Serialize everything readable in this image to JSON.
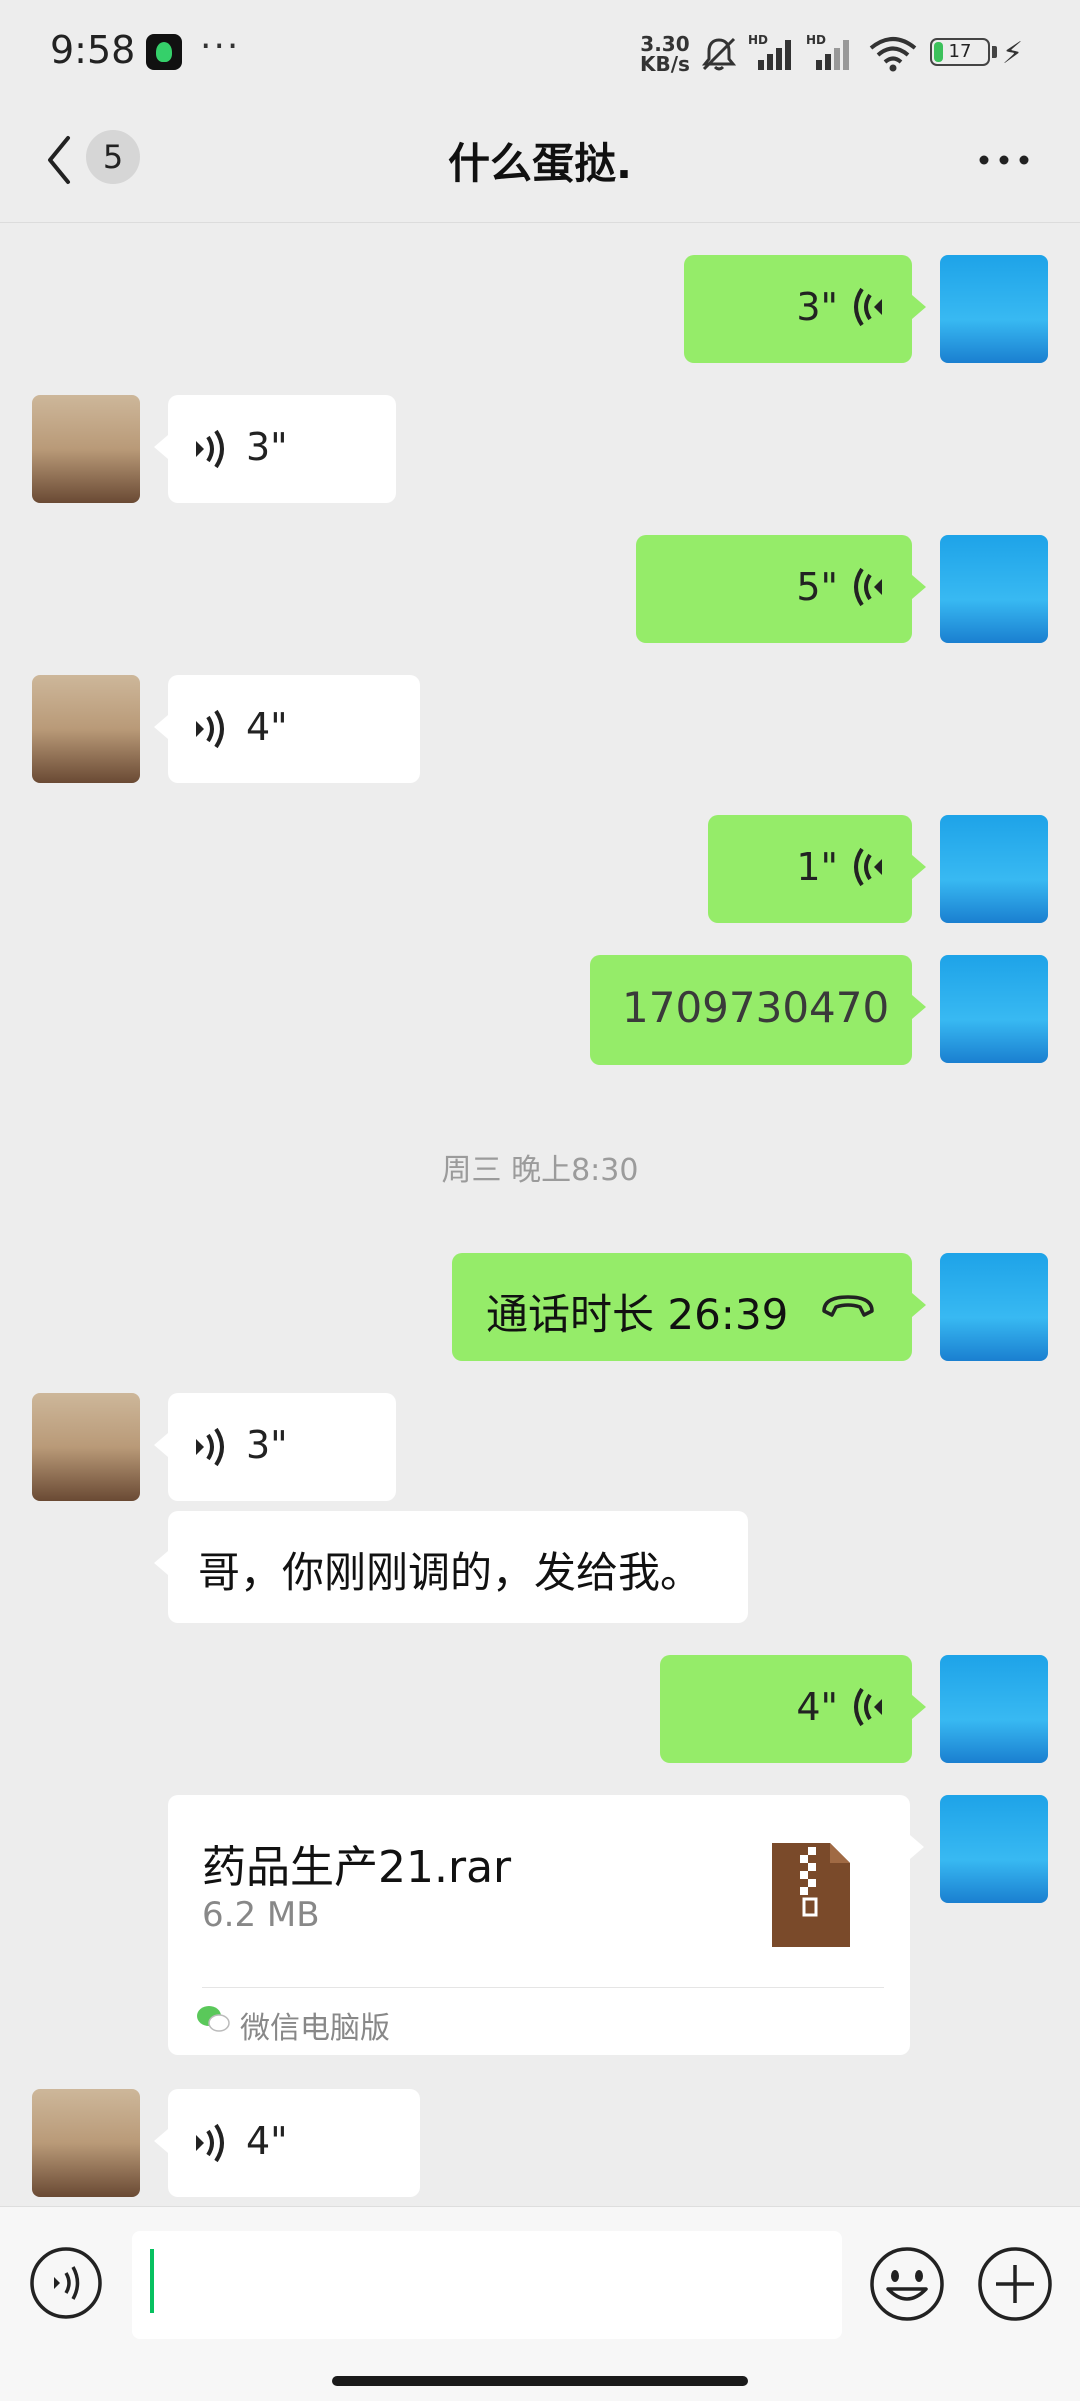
{
  "status_bar": {
    "time": "9:58",
    "overflow": "···",
    "net_speed_value": "3.30",
    "net_speed_unit": "KB/s",
    "signal_label_1": "HD",
    "signal_label_2": "HD",
    "battery_level": "17",
    "battery_fraction": 0.17,
    "icons": [
      "app-icon",
      "mute-bell-icon",
      "signal-icon",
      "wifi-icon",
      "battery-icon",
      "charging-icon"
    ]
  },
  "header": {
    "unread_count": "5",
    "title": "什么蛋挞.",
    "back_icon": "chevron-left-icon",
    "more_icon": "more-dots-icon"
  },
  "messages": [
    {
      "from": "me",
      "type": "voice",
      "duration": "3\""
    },
    {
      "from": "other",
      "type": "voice",
      "duration": "3\""
    },
    {
      "from": "me",
      "type": "voice",
      "duration": "5\""
    },
    {
      "from": "other",
      "type": "voice",
      "duration": "4\""
    },
    {
      "from": "me",
      "type": "voice",
      "duration": "1\""
    },
    {
      "from": "me",
      "type": "text",
      "text": "1709730470"
    },
    {
      "type": "time",
      "text": "周三 晚上8:30"
    },
    {
      "from": "me",
      "type": "call",
      "text": "通话时长 26:39"
    },
    {
      "from": "other",
      "type": "voice",
      "duration": "3\""
    },
    {
      "from": "other",
      "type": "text",
      "text": "哥，你刚刚调的，发给我。"
    },
    {
      "from": "me",
      "type": "voice",
      "duration": "4\""
    },
    {
      "from": "me",
      "type": "file",
      "file_name": "药品生产21.rar",
      "file_size": "6.2 MB",
      "source": "微信电脑版"
    },
    {
      "from": "other",
      "type": "voice",
      "duration": "4\""
    }
  ],
  "input_bar": {
    "placeholder": "",
    "value": "",
    "icons": [
      "voice-input-icon",
      "emoji-icon",
      "plus-icon"
    ]
  },
  "colors": {
    "my_bubble": "#95ec69",
    "their_bubble": "#ffffff",
    "background": "#ededed",
    "caret": "#07c160"
  }
}
